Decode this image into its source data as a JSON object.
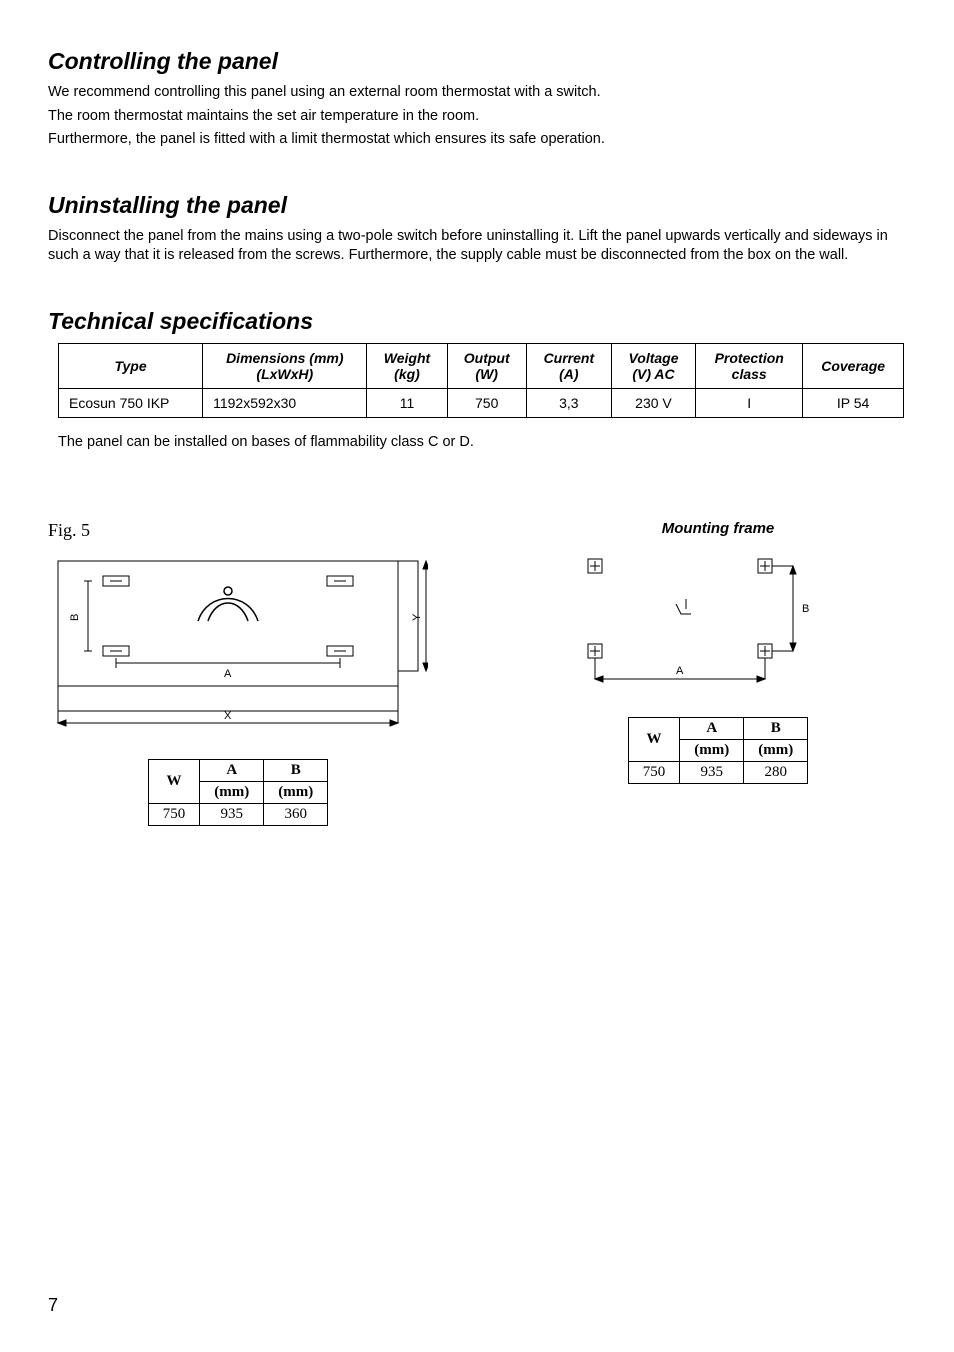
{
  "sections": {
    "controlling": {
      "title": "Controlling the panel",
      "p1": "We recommend controlling this panel using an external room thermostat with a switch.",
      "p2": "The room thermostat maintains the set air temperature in the room.",
      "p3": "Furthermore, the panel is fitted with a limit thermostat which ensures its safe operation."
    },
    "uninstalling": {
      "title": "Uninstalling the panel",
      "p1": "Disconnect the panel from the mains using a two-pole switch before uninstalling it. Lift the panel upwards vertically and sideways in such a way that it is released from the screws. Furthermore, the supply cable must be disconnected from the box on the wall."
    },
    "tech": {
      "title": "Technical specifications",
      "headers": {
        "type": "Type",
        "dim_a": "Dimensions (mm)",
        "dim_b": "(LxWxH)",
        "weight_a": "Weight",
        "weight_b": "(kg)",
        "output_a": "Output",
        "output_b": "(W)",
        "current_a": "Current",
        "current_b": "(A)",
        "volt_a": "Voltage",
        "volt_b": "(V) AC",
        "prot_a": "Protection",
        "prot_b": "class",
        "coverage": "Coverage"
      },
      "row": {
        "type": "Ecosun 750 IKP",
        "dim": "1192x592x30",
        "weight": "11",
        "output": "750",
        "current": "3,3",
        "volt": "230 V",
        "prot": "I",
        "coverage": "IP 54"
      },
      "note": "The panel can be installed on bases of flammability class C or D."
    }
  },
  "figures": {
    "fig5": {
      "label": "Fig. 5",
      "axis_a": "A",
      "axis_x": "X",
      "axis_b": "B",
      "axis_y": "Y",
      "wab": {
        "h_w": "W",
        "h_a": "A",
        "h_a2": "(mm)",
        "h_b": "B",
        "h_b2": "(mm)",
        "w": "750",
        "a": "935",
        "b": "360"
      }
    },
    "frame": {
      "title": "Mounting frame",
      "axis_a": "A",
      "axis_b": "B",
      "wab": {
        "h_w": "W",
        "h_a": "A",
        "h_a2": "(mm)",
        "h_b": "B",
        "h_b2": "(mm)",
        "w": "750",
        "a": "935",
        "b": "280"
      }
    }
  },
  "page_number": "7"
}
